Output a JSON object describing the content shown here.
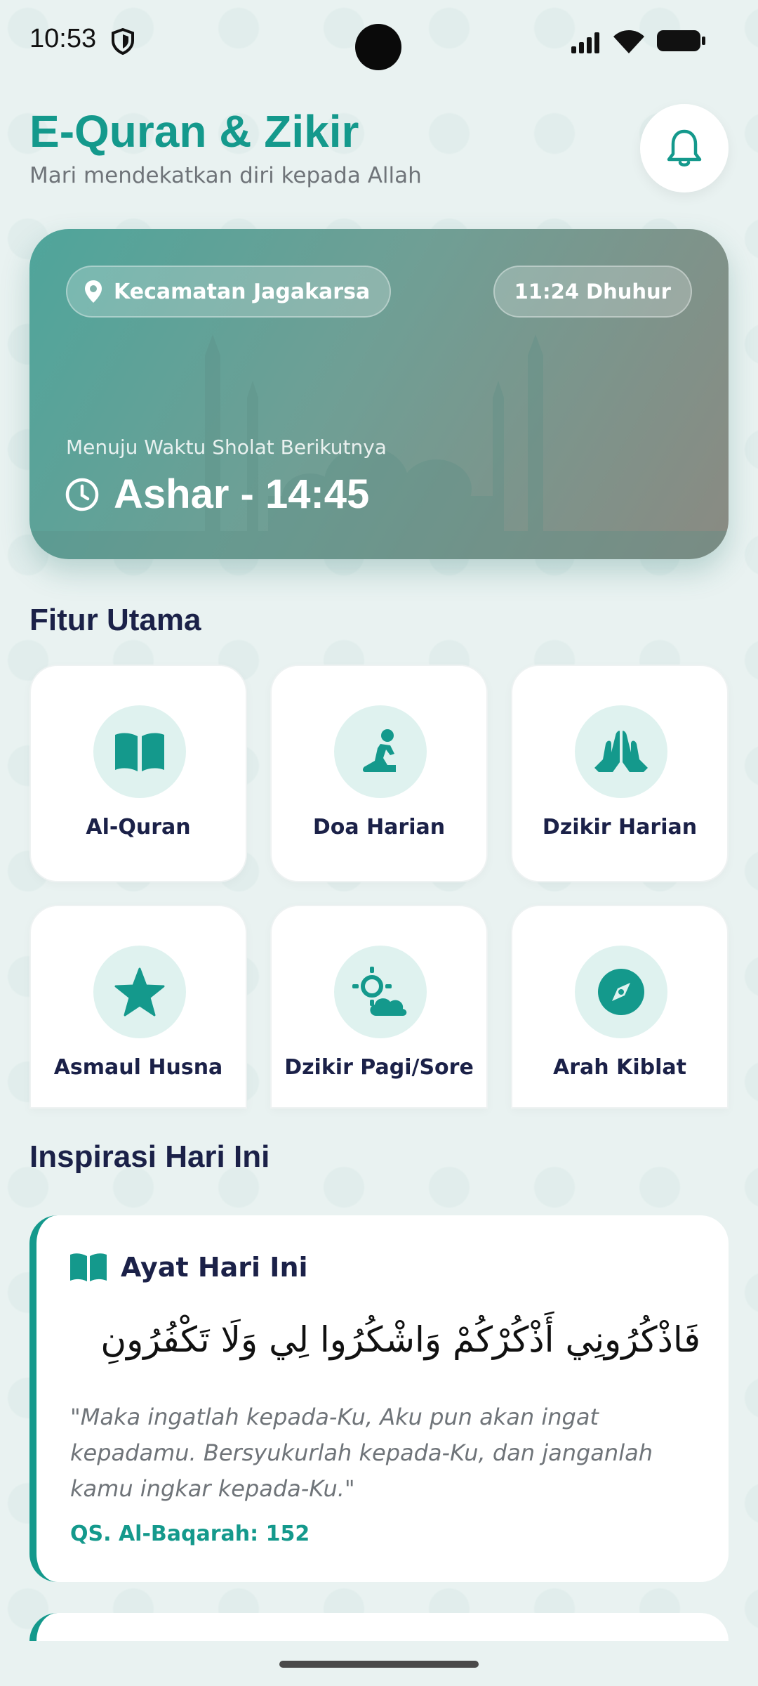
{
  "status_bar": {
    "time": "10:53"
  },
  "header": {
    "title": "E-Quran & Zikir",
    "subtitle": "Mari mendekatkan diri kepada Allah"
  },
  "prayer_card": {
    "location": "Kecamatan Jagakarsa",
    "current_time": "11:24 Dhuhur",
    "next_label": "Menuju Waktu Sholat Berikutnya",
    "next_prayer": "Ashar - 14:45"
  },
  "features": {
    "title": "Fitur Utama",
    "items": [
      {
        "label": "Al-Quran",
        "icon": "book-open-icon"
      },
      {
        "label": "Doa Harian",
        "icon": "praying-person-icon"
      },
      {
        "label": "Dzikir Harian",
        "icon": "praying-hands-icon"
      },
      {
        "label": "Asmaul Husna",
        "icon": "star-icon"
      },
      {
        "label": "Dzikir Pagi/Sore",
        "icon": "sun-cloud-icon"
      },
      {
        "label": "Arah Kiblat",
        "icon": "compass-icon"
      }
    ]
  },
  "inspiration": {
    "title": "Inspirasi Hari Ini",
    "card_title": "Ayat Hari Ini",
    "arabic": "فَاذْكُرُونِي أَذْكُرْكُمْ وَاشْكُرُوا لِي وَلَا تَكْفُرُونِ",
    "translation": "\"Maka ingatlah kepada-Ku, Aku pun akan ingat kepadamu. Bersyukurlah kepada-Ku, dan janganlah kamu ingkar kepada-Ku.\"",
    "reference": "QS. Al-Baqarah: 152"
  },
  "colors": {
    "accent": "#14998c",
    "heading": "#1b2148",
    "background": "#e9f2f1",
    "icon_bg": "#dff2ef"
  }
}
